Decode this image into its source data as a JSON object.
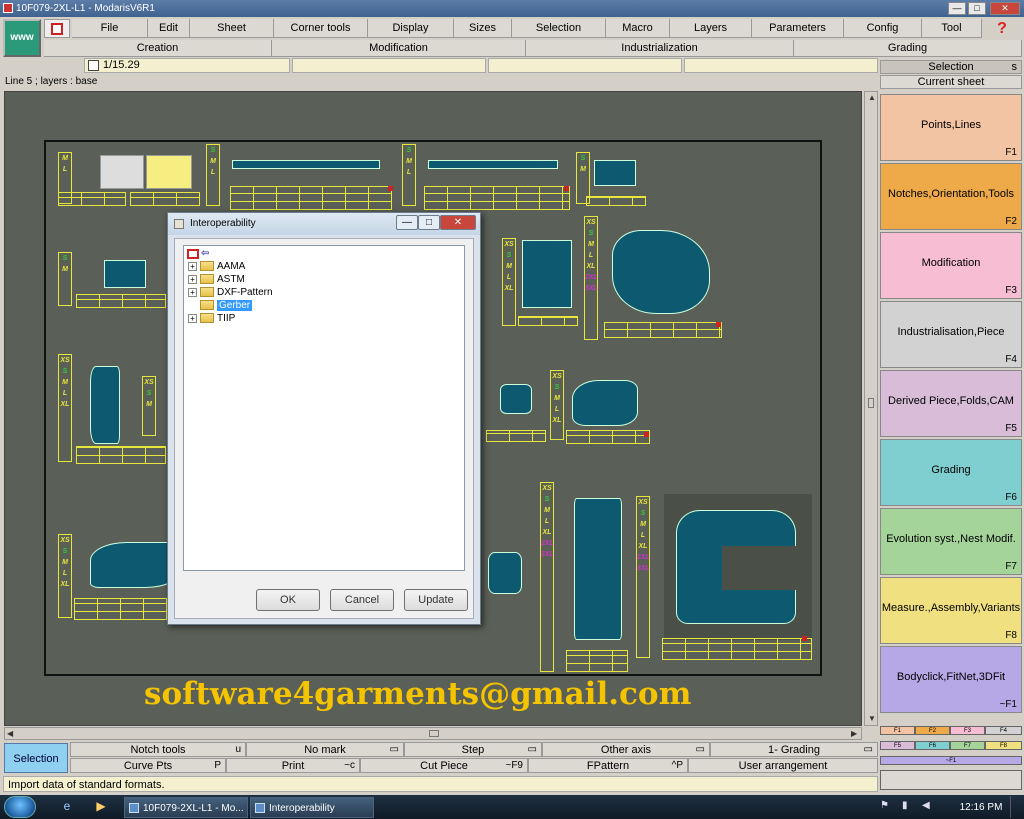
{
  "window": {
    "title": "10F079-2XL-L1 - ModarisV6R1",
    "min": "—",
    "max": "□",
    "close": "✕"
  },
  "toolbar": {
    "www": "www"
  },
  "menu": [
    {
      "id": "file",
      "label": "File"
    },
    {
      "id": "edit",
      "label": "Edit"
    },
    {
      "id": "sheet",
      "label": "Sheet"
    },
    {
      "id": "corner-tools",
      "label": "Corner tools"
    },
    {
      "id": "display",
      "label": "Display"
    },
    {
      "id": "sizes",
      "label": "Sizes"
    },
    {
      "id": "selection",
      "label": "Selection"
    },
    {
      "id": "macro",
      "label": "Macro"
    },
    {
      "id": "layers",
      "label": "Layers"
    },
    {
      "id": "parameters",
      "label": "Parameters"
    },
    {
      "id": "config",
      "label": "Config"
    },
    {
      "id": "tool",
      "label": "Tool"
    }
  ],
  "help": "?",
  "categories": [
    "Creation",
    "Modification",
    "Industrialization",
    "Grading"
  ],
  "status": {
    "scale": "1/15.29",
    "line_info": "Line 5   ;     layers :  base"
  },
  "right_panel": {
    "header": "Selection",
    "header_key": "s",
    "current_sheet": "Current sheet",
    "buttons": [
      {
        "label": "Points,Lines",
        "key": "F1",
        "color": "#f2c4a4"
      },
      {
        "label": "Notches,Orientation,Tools",
        "key": "F2",
        "color": "#eeaa48"
      },
      {
        "label": "Modification",
        "key": "F3",
        "color": "#f6bdd3"
      },
      {
        "label": "Industrialisation,Piece",
        "key": "F4",
        "color": "#d2d2d2"
      },
      {
        "label": "Derived Piece,Folds,CAM",
        "key": "F5",
        "color": "#d8bcd8"
      },
      {
        "label": "Grading",
        "key": "F6",
        "color": "#80cfd0"
      },
      {
        "label": "Evolution syst.,Nest Modif.",
        "key": "F7",
        "color": "#a5d49a"
      },
      {
        "label": "Measure.,Assembly,Variants",
        "key": "F8",
        "color": "#f0e080"
      },
      {
        "label": "Bodyclick,FitNet,3DFit",
        "key": "~F1",
        "color": "#b6a8e6"
      }
    ],
    "mini_labels": [
      "F1",
      "F2",
      "F3",
      "F4",
      "F5",
      "F6",
      "F7",
      "F8",
      "~F1"
    ]
  },
  "bottom": {
    "selection": "Selection",
    "row1": [
      {
        "label": "Notch tools",
        "key": "u"
      },
      {
        "label": "No mark",
        "key": "▭"
      },
      {
        "label": "Step",
        "key": "▭"
      },
      {
        "label": "Other axis",
        "key": "▭"
      },
      {
        "label": "1- Grading",
        "key": "▭"
      }
    ],
    "row2": [
      {
        "label": "Curve Pts",
        "key": "P"
      },
      {
        "label": "Print",
        "key": "~c"
      },
      {
        "label": "Cut Piece",
        "key": "~F9"
      },
      {
        "label": "FPattern",
        "key": "^P"
      },
      {
        "label": "User arrangement",
        "key": ""
      }
    ],
    "hint": "Import data of standard formats."
  },
  "watermark": "software4garments@gmail.com",
  "sizes": [
    "XS",
    "S",
    "M",
    "L",
    "XL",
    "2XL",
    "3XL"
  ],
  "dialog": {
    "title": "Interoperability",
    "items": [
      {
        "label": "AAMA",
        "expandable": true
      },
      {
        "label": "ASTM",
        "expandable": true
      },
      {
        "label": "DXF-Pattern",
        "expandable": true
      },
      {
        "label": "Gerber",
        "expandable": false,
        "selected": true
      },
      {
        "label": "TIIP",
        "expandable": true
      }
    ],
    "expander": "+",
    "root_arrow": "⇦",
    "ok": "OK",
    "cancel": "Cancel",
    "update": "Update"
  },
  "taskbar": {
    "tasks": [
      "10F079-2XL-L1 - Mo...",
      "Interoperability"
    ],
    "time": "12:16 PM"
  }
}
